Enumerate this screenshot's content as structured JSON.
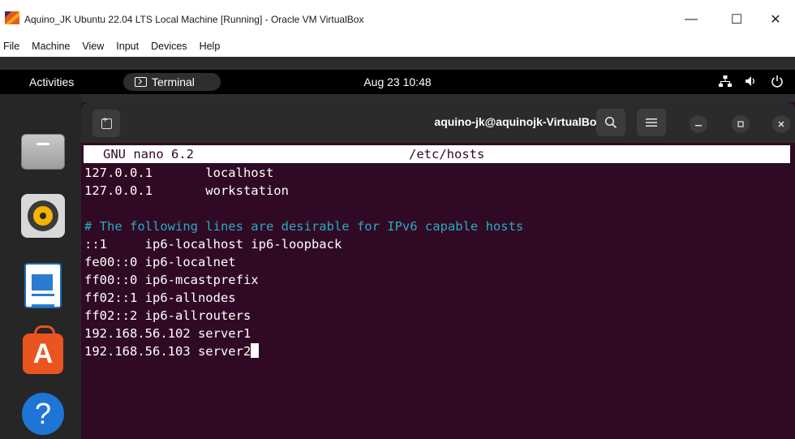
{
  "vbox": {
    "title": "Aquino_JK Ubuntu 22.04 LTS Local Machine [Running] - Oracle VM VirtualBox",
    "menu": [
      "File",
      "Machine",
      "View",
      "Input",
      "Devices",
      "Help"
    ],
    "controls": {
      "minimize": "—",
      "maximize": "☐",
      "close": "✕"
    }
  },
  "topbar": {
    "activities": "Activities",
    "app_name": "Terminal",
    "clock": "Aug 23  10:48",
    "icons": [
      "network-icon",
      "volume-icon",
      "power-icon"
    ]
  },
  "dock": {
    "items": [
      "files",
      "rhythmbox",
      "libreoffice-writer",
      "ubuntu-software",
      "help"
    ]
  },
  "terminal": {
    "title": "aquino-jk@aquinojk-VirtualBox: ~",
    "nano_version": "GNU nano 6.2",
    "file_name": "/etc/hosts",
    "lines": [
      "127.0.0.1       localhost",
      "127.0.0.1       workstation",
      "",
      "# The following lines are desirable for IPv6 capable hosts",
      "::1     ip6-localhost ip6-loopback",
      "fe00::0 ip6-localnet",
      "ff00::0 ip6-mcastprefix",
      "ff02::1 ip6-allnodes",
      "ff02::2 ip6-allrouters",
      "192.168.56.102 server1",
      "192.168.56.103 server2"
    ]
  },
  "colors": {
    "terminal_bg": "#300a24",
    "comment": "#2ba9c4",
    "ubuntu_orange": "#e95420"
  }
}
